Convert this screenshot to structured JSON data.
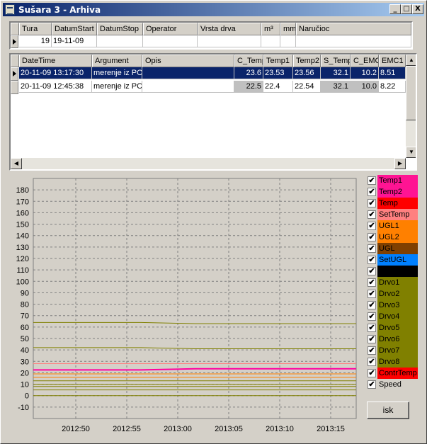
{
  "window": {
    "title": "Sušara 3 - Arhiva",
    "btn_min": "_",
    "btn_max": "□",
    "btn_close": "X"
  },
  "top_table": {
    "headers": [
      "Tura",
      "DatumStart",
      "DatumStop",
      "Operator",
      "Vrsta drva",
      "m³",
      "mm",
      "Naručioc"
    ],
    "row": [
      "19",
      "19-11-09",
      "",
      "",
      "",
      "",
      "",
      ""
    ]
  },
  "log_table": {
    "headers": [
      "DateTime",
      "Argument",
      "Opis",
      "C_Temp",
      "Temp1",
      "Temp2",
      "S_Temp",
      "C_EMC",
      "EMC1"
    ],
    "rows": [
      [
        "20-11-09 13:17:30",
        "merenje iz PC",
        "",
        "23.6",
        "23.53",
        "23.56",
        "32.1",
        "10.2",
        "8.51"
      ],
      [
        "20-11-09 12:45:38",
        "merenje iz PC",
        "",
        "22.5",
        "22.4",
        "22.54",
        "32.1",
        "10.0",
        "8.22"
      ]
    ]
  },
  "chart_data": {
    "type": "line",
    "ylim": [
      -20,
      190
    ],
    "y_ticks": [
      -10,
      0,
      10,
      20,
      30,
      40,
      50,
      60,
      70,
      80,
      90,
      100,
      110,
      120,
      130,
      140,
      150,
      160,
      170,
      180
    ],
    "x_ticks": [
      "20:12:50",
      "20:12:55",
      "20:13:00",
      "20:13:05",
      "20:13:10",
      "20:13:15"
    ],
    "x_tick_labels": [
      "2012:50",
      "2012:55",
      "2013:00",
      "2013:05",
      "2013:10",
      "2013:15"
    ],
    "grid": true,
    "series": [
      {
        "name": "Drvo1",
        "color": "#808000",
        "values": [
          64,
          64,
          64,
          63,
          63,
          63,
          63
        ]
      },
      {
        "name": "Drvo2",
        "color": "#808000",
        "values": [
          42,
          42,
          42,
          41,
          41,
          41,
          41
        ]
      },
      {
        "name": "Temp1",
        "color": "#ff00a0",
        "values": [
          22.5,
          22.5,
          22.5,
          23.5,
          23.5,
          23.5,
          23.5
        ]
      },
      {
        "name": "SetTemp",
        "color": "#ff8080",
        "values": [
          28,
          28,
          28,
          28,
          28,
          28,
          28
        ]
      },
      {
        "name": "UGL1",
        "color": "#ff8000",
        "values": [
          19,
          19,
          19,
          19,
          19,
          19,
          19
        ]
      },
      {
        "name": "UGL2",
        "color": "#ff8000",
        "values": [
          16,
          16,
          16,
          16,
          16,
          16,
          16
        ]
      },
      {
        "name": "Drvo3",
        "color": "#808000",
        "values": [
          13,
          13,
          13,
          13,
          13,
          13,
          13
        ]
      },
      {
        "name": "Drvo4",
        "color": "#808000",
        "values": [
          10,
          10,
          10,
          10,
          10,
          10,
          10
        ]
      },
      {
        "name": "Drvo5",
        "color": "#808000",
        "values": [
          8,
          8,
          8,
          8,
          8,
          8,
          8
        ]
      },
      {
        "name": "Drvo6",
        "color": "#808000",
        "values": [
          5,
          5,
          5,
          5,
          5,
          5,
          5
        ]
      },
      {
        "name": "Speed",
        "color": "#808000",
        "values": [
          0,
          0,
          0,
          0,
          0,
          0,
          0
        ]
      }
    ]
  },
  "legend": [
    {
      "label": "Temp1",
      "bg": "#ff1493",
      "fg": "#000000",
      "checked": "✔"
    },
    {
      "label": "Temp2",
      "bg": "#ff1493",
      "fg": "#000000",
      "checked": "✔"
    },
    {
      "label": "Temp",
      "bg": "#ff0000",
      "fg": "#000000",
      "checked": "✔"
    },
    {
      "label": "SetTemp",
      "bg": "#ff8080",
      "fg": "#000000",
      "checked": "✔"
    },
    {
      "label": "UGL1",
      "bg": "#ff8000",
      "fg": "#000000",
      "checked": "✔"
    },
    {
      "label": "UGL2",
      "bg": "#ff8000",
      "fg": "#000000",
      "checked": "✔"
    },
    {
      "label": "UGL",
      "bg": "#804000",
      "fg": "#000000",
      "checked": "✔"
    },
    {
      "label": "SetUGL",
      "bg": "#0080ff",
      "fg": "#000000",
      "checked": "✔"
    },
    {
      "label": "",
      "bg": "#000000",
      "fg": "#ffffff",
      "checked": "✔"
    },
    {
      "label": "Drvo1",
      "bg": "#808000",
      "fg": "#000000",
      "checked": "✔"
    },
    {
      "label": "Drvo2",
      "bg": "#808000",
      "fg": "#000000",
      "checked": "✔"
    },
    {
      "label": "Drvo3",
      "bg": "#808000",
      "fg": "#000000",
      "checked": "✔"
    },
    {
      "label": "Drvo4",
      "bg": "#808000",
      "fg": "#000000",
      "checked": "✔"
    },
    {
      "label": "Drvo5",
      "bg": "#808000",
      "fg": "#000000",
      "checked": "✔"
    },
    {
      "label": "Drvo6",
      "bg": "#808000",
      "fg": "#000000",
      "checked": "✔"
    },
    {
      "label": "Drvo7",
      "bg": "#808000",
      "fg": "#000000",
      "checked": "✔"
    },
    {
      "label": "Drvo8",
      "bg": "#808000",
      "fg": "#000000",
      "checked": "✔"
    },
    {
      "label": "ContrTemp",
      "bg": "#ff0000",
      "fg": "#000000",
      "checked": "✔"
    },
    {
      "label": "Speed",
      "bg": "#d4d0c8",
      "fg": "#000000",
      "checked": "✔"
    }
  ],
  "button": {
    "label": "isk"
  }
}
